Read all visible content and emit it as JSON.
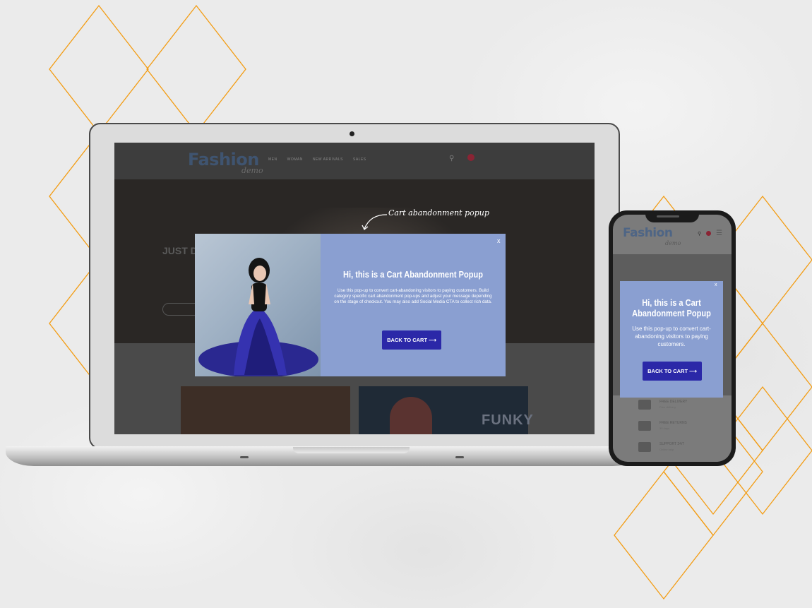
{
  "theme": {
    "accent": "#f39c12",
    "popup_bg": "#8a9fd1",
    "cta_bg": "#2b28a8"
  },
  "desktop": {
    "logo": "Fashion",
    "logo_sub": "demo",
    "nav": [
      "MEN",
      "WOMAN",
      "NEW ARRIVALS",
      "SALES"
    ],
    "hero_title": "JUST D",
    "tile_text": "FUNKY"
  },
  "annotation": "Cart abandonment popup",
  "popup": {
    "close": "x",
    "title": "Hi, this is a Cart Abandonment Popup",
    "body": "Use this pop-up to convert cart-abandoning visitors to paying customers. Build category specific cart abandonment pop-ups and adjust your message depending on the stage of checkout. You may also add Social Media CTA to collect rich data.",
    "button": "BACK TO CART ⟶"
  },
  "mobile": {
    "logo": "Fashion",
    "logo_sub": "demo",
    "popup": {
      "close": "x",
      "title": "Hi, this is a Cart Abandonment Popup",
      "body": "Use this pop-up to convert cart-abandoning visitors to paying customers.",
      "button": "BACK TO CART ⟶"
    },
    "list": [
      {
        "l1": "FREE DELIVERY",
        "l2": "Free delivery"
      },
      {
        "l1": "FREE RETURNS",
        "l2": "30 days"
      },
      {
        "l1": "SUPPORT 24/7",
        "l2": "Online help"
      }
    ]
  }
}
